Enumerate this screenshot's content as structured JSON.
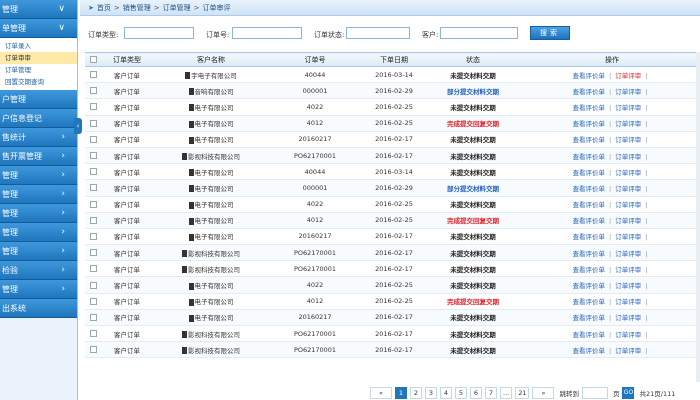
{
  "sidebar": {
    "menus": [
      {
        "label": "管理",
        "dark": false
      },
      {
        "label": "单管理",
        "dark": false
      }
    ],
    "submenu": [
      {
        "label": "订单录入",
        "active": false
      },
      {
        "label": "订单审审",
        "active": true
      },
      {
        "label": "订单管理",
        "active": false
      },
      {
        "label": "回置交期查询",
        "active": false
      }
    ],
    "menus2": [
      {
        "label": "户管理"
      },
      {
        "label": "户信息登记"
      },
      {
        "label": "售统计"
      },
      {
        "label": "售开票管理"
      },
      {
        "label": "管理"
      },
      {
        "label": "管理"
      },
      {
        "label": "管理"
      },
      {
        "label": "管理"
      },
      {
        "label": "管理"
      },
      {
        "label": "检验"
      },
      {
        "label": "管理"
      },
      {
        "label": "出系统"
      }
    ]
  },
  "breadcrumb": [
    "首页",
    "销售管理",
    "订单管理",
    "订单审评"
  ],
  "filters": {
    "order_type_label": "订单类型:",
    "order_no_label": "订单号:",
    "order_status_label": "订单状态:",
    "customer_label": "客户:",
    "search_label": "搜索"
  },
  "table": {
    "headers": [
      "订单类型",
      "客户名称",
      "订单号",
      "下单日期",
      "状态",
      "操作"
    ],
    "rows": [
      {
        "type": "客户订单",
        "customer": "宇电子有限公司",
        "order_no": "40044",
        "date": "2016-03-14",
        "status": "未提交材料交期",
        "status_class": "st-bold",
        "a1": "查看评价单",
        "a2": "订单评审",
        "a2red": true
      },
      {
        "type": "客户订单",
        "customer": "音响有限公司",
        "order_no": "000001",
        "date": "2016-02-29",
        "status": "部分提交材料交期",
        "status_class": "st-blue",
        "a1": "查看评价单",
        "a2": "订单评审",
        "a2red": false
      },
      {
        "type": "客户订单",
        "customer": "电子有限公司",
        "order_no": "4022",
        "date": "2016-02-25",
        "status": "未提交材料交期",
        "status_class": "st-bold",
        "a1": "查看评价单",
        "a2": "订单评审",
        "a2red": false
      },
      {
        "type": "客户订单",
        "customer": "电子有限公司",
        "order_no": "4012",
        "date": "2016-02-25",
        "status": "完成提交回复交期",
        "status_class": "st-red",
        "a1": "查看评价单",
        "a2": "订单评审",
        "a2red": false
      },
      {
        "type": "客户订单",
        "customer": "电子有限公司",
        "order_no": "20160217",
        "date": "2016-02-17",
        "status": "未提交材料交期",
        "status_class": "st-bold",
        "a1": "查看评价单",
        "a2": "订单评审",
        "a2red": false
      },
      {
        "type": "客户订单",
        "customer": "影视科技有限公司",
        "order_no": "PO62170001",
        "date": "2016-02-17",
        "status": "未提交材料交期",
        "status_class": "st-bold",
        "a1": "查看评价单",
        "a2": "订单评审",
        "a2red": false
      },
      {
        "type": "客户订单",
        "customer": "电子有限公司",
        "order_no": "40044",
        "date": "2016-03-14",
        "status": "未提交材料交期",
        "status_class": "st-bold",
        "a1": "查看评价单",
        "a2": "订单评审",
        "a2red": false
      },
      {
        "type": "客户订单",
        "customer": "电子有限公司",
        "order_no": "000001",
        "date": "2016-02-29",
        "status": "部分提交材料交期",
        "status_class": "st-blue",
        "a1": "查看评价单",
        "a2": "订单评审",
        "a2red": false
      },
      {
        "type": "客户订单",
        "customer": "电子有限公司",
        "order_no": "4022",
        "date": "2016-02-25",
        "status": "未提交材料交期",
        "status_class": "st-bold",
        "a1": "查看评价单",
        "a2": "订单评审",
        "a2red": false
      },
      {
        "type": "客户订单",
        "customer": "电子有限公司",
        "order_no": "4012",
        "date": "2016-02-25",
        "status": "完成提交回复交期",
        "status_class": "st-red",
        "a1": "查看评价单",
        "a2": "订单评审",
        "a2red": false
      },
      {
        "type": "客户订单",
        "customer": "电子有限公司",
        "order_no": "20160217",
        "date": "2016-02-17",
        "status": "未提交材料交期",
        "status_class": "st-bold",
        "a1": "查看评价单",
        "a2": "订单评审",
        "a2red": false
      },
      {
        "type": "客户订单",
        "customer": "影视科技有限公司",
        "order_no": "PO62170001",
        "date": "2016-02-17",
        "status": "未提交材料交期",
        "status_class": "st-bold",
        "a1": "查看评价单",
        "a2": "订单评审",
        "a2red": false
      },
      {
        "type": "客户订单",
        "customer": "影视科技有限公司",
        "order_no": "PO62170001",
        "date": "2016-02-17",
        "status": "未提交材料交期",
        "status_class": "st-bold",
        "a1": "查看评价单",
        "a2": "订单评审",
        "a2red": false
      },
      {
        "type": "客户订单",
        "customer": "电子有限公司",
        "order_no": "4022",
        "date": "2016-02-25",
        "status": "未提交材料交期",
        "status_class": "st-bold",
        "a1": "查看评价单",
        "a2": "订单评审",
        "a2red": false
      },
      {
        "type": "客户订单",
        "customer": "电子有限公司",
        "order_no": "4012",
        "date": "2016-02-25",
        "status": "完成提交回复交期",
        "status_class": "st-red",
        "a1": "查看评价单",
        "a2": "订单评审",
        "a2red": false
      },
      {
        "type": "客户订单",
        "customer": "电子有限公司",
        "order_no": "20160217",
        "date": "2016-02-17",
        "status": "未提交材料交期",
        "status_class": "st-bold",
        "a1": "查看评价单",
        "a2": "订单评审",
        "a2red": false
      },
      {
        "type": "客户订单",
        "customer": "影视科技有限公司",
        "order_no": "PO62170001",
        "date": "2016-02-17",
        "status": "未提交材料交期",
        "status_class": "st-bold",
        "a1": "查看评价单",
        "a2": "订单评审",
        "a2red": false
      },
      {
        "type": "客户订单",
        "customer": "影视科技有限公司",
        "order_no": "PO62170001",
        "date": "2016-02-17",
        "status": "未提交材料交期",
        "status_class": "st-bold",
        "a1": "查看评价单",
        "a2": "订单评审",
        "a2red": false
      }
    ]
  },
  "pagination": {
    "prev": "«",
    "pages": [
      "1",
      "2",
      "3",
      "4",
      "5",
      "6",
      "7",
      "...",
      "21"
    ],
    "next": "»",
    "jump_label": "跳转到",
    "page_unit": "页",
    "go": "GO",
    "summary": "共21页/111"
  }
}
